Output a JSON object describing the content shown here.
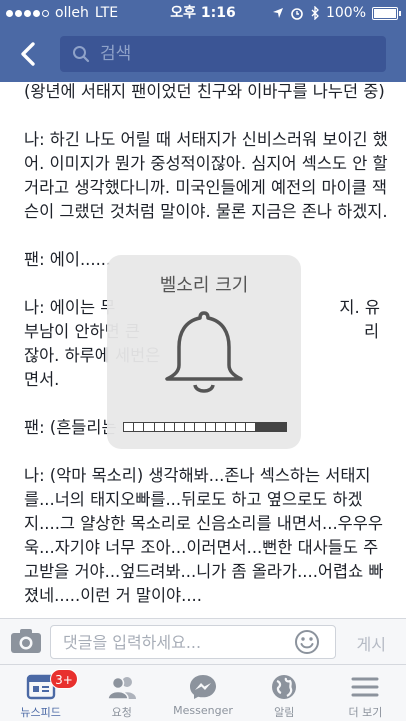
{
  "status_bar": {
    "carrier": "olleh",
    "network": "LTE",
    "time": "오후 1:16",
    "battery": "100%"
  },
  "header": {
    "search_placeholder": "검색"
  },
  "post": {
    "paragraphs": [
      "(왕년에 서태지 팬이었던 친구와 이바구를 나누던 중)",
      "나: 하긴 나도 어릴 때 서태지가 신비스러워 보이긴 했어. 이미지가 뭔가 중성적이잖아. 심지어 섹스도 안 할거라고 생각했다니까. 미국인들에게 예전의 마이클 잭슨이 그랬던 것처럼 말이야. 물론 지금은 존나 하겠지.",
      "팬: 에이......",
      "나: 에이는 무                                           지. 유부남이 안하면 큰                                           리잖아. 하루에 세번은                                           면서.",
      "팬: (흔들리는",
      "나: (악마 목소리) 생각해봐...존나 섹스하는 서태지를...너의 태지오빠를...뒤로도 하고 옆으로도 하겠지....그 얄상한 목소리로 신음소리를 내면서...우우우욱...자기야 너무 조아...이러면서...뻔한 대사들도 주고받을 거야...엎드려봐...니가 좀 올라가....어렵쇼 빠졌네.....이런 거 말이야...."
    ]
  },
  "volume_hud": {
    "title": "벨소리 크기",
    "level_fraction": 0.81
  },
  "composer": {
    "placeholder": "댓글을 입력하세요...",
    "post_label": "게시"
  },
  "tabbar": {
    "items": [
      {
        "label": "뉴스피드",
        "icon": "news-feed-icon",
        "active": true,
        "badge": "3+"
      },
      {
        "label": "요청",
        "icon": "friend-requests-icon"
      },
      {
        "label": "Messenger",
        "icon": "messenger-icon"
      },
      {
        "label": "알림",
        "icon": "globe-notifications-icon"
      },
      {
        "label": "더 보기",
        "icon": "menu-icon"
      }
    ]
  },
  "colors": {
    "brand": "#4b69a5",
    "badge": "#e8302e"
  }
}
